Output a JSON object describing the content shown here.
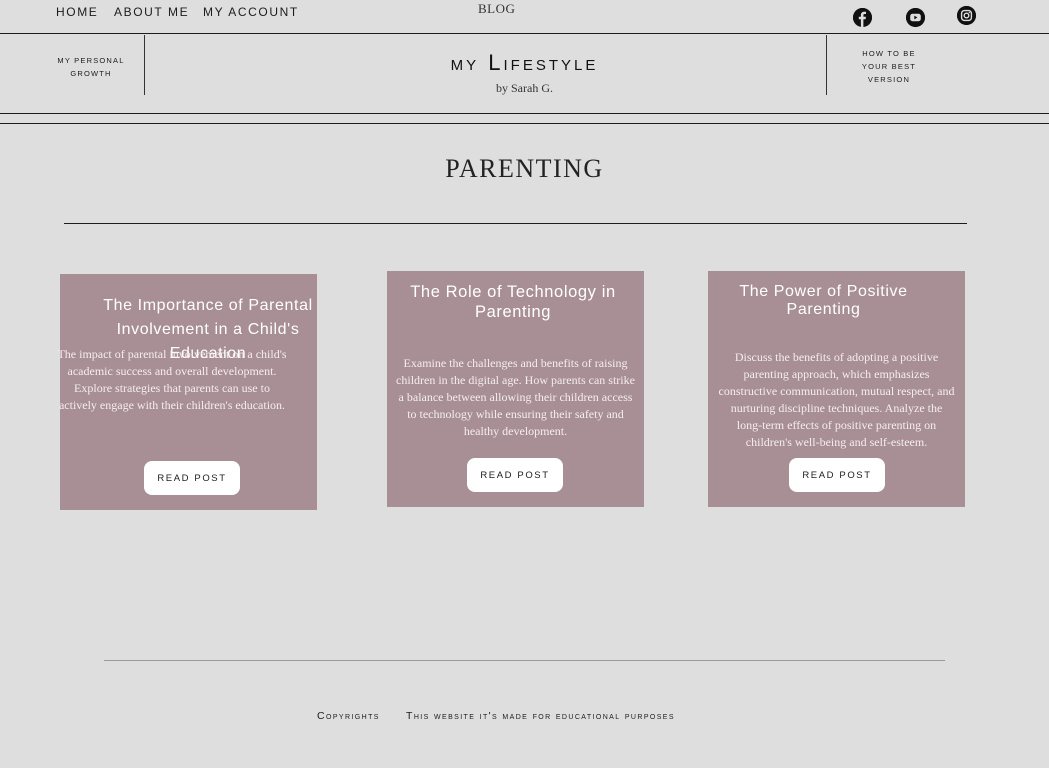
{
  "nav": {
    "home": "HOME",
    "about": "ABOUT ME",
    "account": "MY ACCOUNT",
    "blog": "BLOG"
  },
  "social": [
    {
      "icon": "facebook-icon"
    },
    {
      "icon": "youtube-icon"
    },
    {
      "icon": "instagram-icon"
    }
  ],
  "header": {
    "left_link": "my personal growth",
    "title": "my Lifestyle",
    "subtitle": "by Sarah G.",
    "right_link": "How to be your best version"
  },
  "section": {
    "title": "PARENTING"
  },
  "cards": [
    {
      "title": "The Importance of Parental Involvement in a Child's Education",
      "description": "The impact of parental involvement on a child's academic success and overall development. Explore strategies that parents can use to actively engage with their children's education.",
      "button": "READ POST"
    },
    {
      "title": "The Role of Technology in Parenting",
      "description": "Examine the challenges and benefits of raising children in the digital age. How parents can strike a balance between allowing their children access to technology while ensuring their safety and healthy development.",
      "button": "READ POST"
    },
    {
      "title": "The Power of Positive Parenting",
      "description": "Discuss the benefits of adopting a positive parenting approach, which emphasizes constructive communication, mutual respect, and nurturing discipline techniques. Analyze the long-term effects of positive parenting on children's well-being and self-esteem.",
      "button": "READ POST"
    }
  ],
  "footer": {
    "copyright": "Copyrights",
    "note": "This website it's made for educational purposes"
  },
  "colors": {
    "background": "#dedede",
    "card": "#a88e95",
    "text": "#1c1c1c"
  }
}
